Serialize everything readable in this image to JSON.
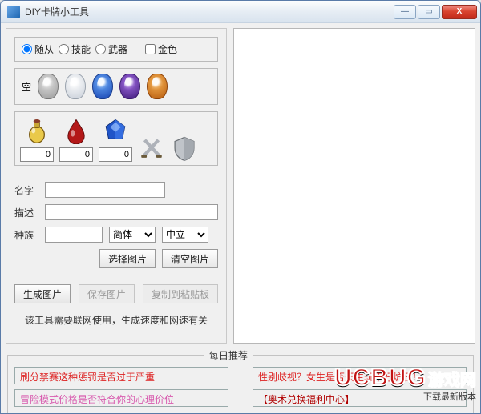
{
  "window": {
    "title": "DIY卡牌小工具"
  },
  "type_group": {
    "options": [
      {
        "label": "随从",
        "checked": true
      },
      {
        "label": "技能",
        "checked": false
      },
      {
        "label": "武器",
        "checked": false
      }
    ],
    "gold_label": "金色",
    "gold_checked": false
  },
  "rarity": {
    "label": "空",
    "gems": [
      "empty",
      "white",
      "blue",
      "purple",
      "orange"
    ]
  },
  "resources": {
    "icons": [
      "flask",
      "blood-drop",
      "mana-crystal",
      "crossed-swords",
      "shield"
    ],
    "values": [
      "0",
      "0",
      "0"
    ]
  },
  "fields": {
    "name_label": "名字",
    "name_value": "",
    "desc_label": "描述",
    "desc_value": "",
    "race_label": "种族",
    "race_value": "",
    "lang_options": [
      "简体"
    ],
    "lang_value": "简体",
    "faction_options": [
      "中立"
    ],
    "faction_value": "中立"
  },
  "buttons": {
    "choose_image": "选择图片",
    "clear_image": "清空图片",
    "generate": "生成图片",
    "save": "保存图片",
    "copy": "复制到粘贴板"
  },
  "note": "该工具需要联网使用，生成速度和网速有关",
  "daily": {
    "legend": "每日推荐",
    "links": [
      {
        "text": "刷分禁赛这种惩罚是否过于严重",
        "cls": "red"
      },
      {
        "text": "性别歧视？女生是否天生玩不好炉石！",
        "cls": "red"
      },
      {
        "text": "冒险模式价格是否符合你的心理价位",
        "cls": "pink"
      },
      {
        "text": "【奥术兑换福利中心】",
        "cls": "dred"
      }
    ]
  },
  "watermark": {
    "brand": "UCBUG",
    "cn": "游戏网",
    "sub": "下载最新版本"
  }
}
